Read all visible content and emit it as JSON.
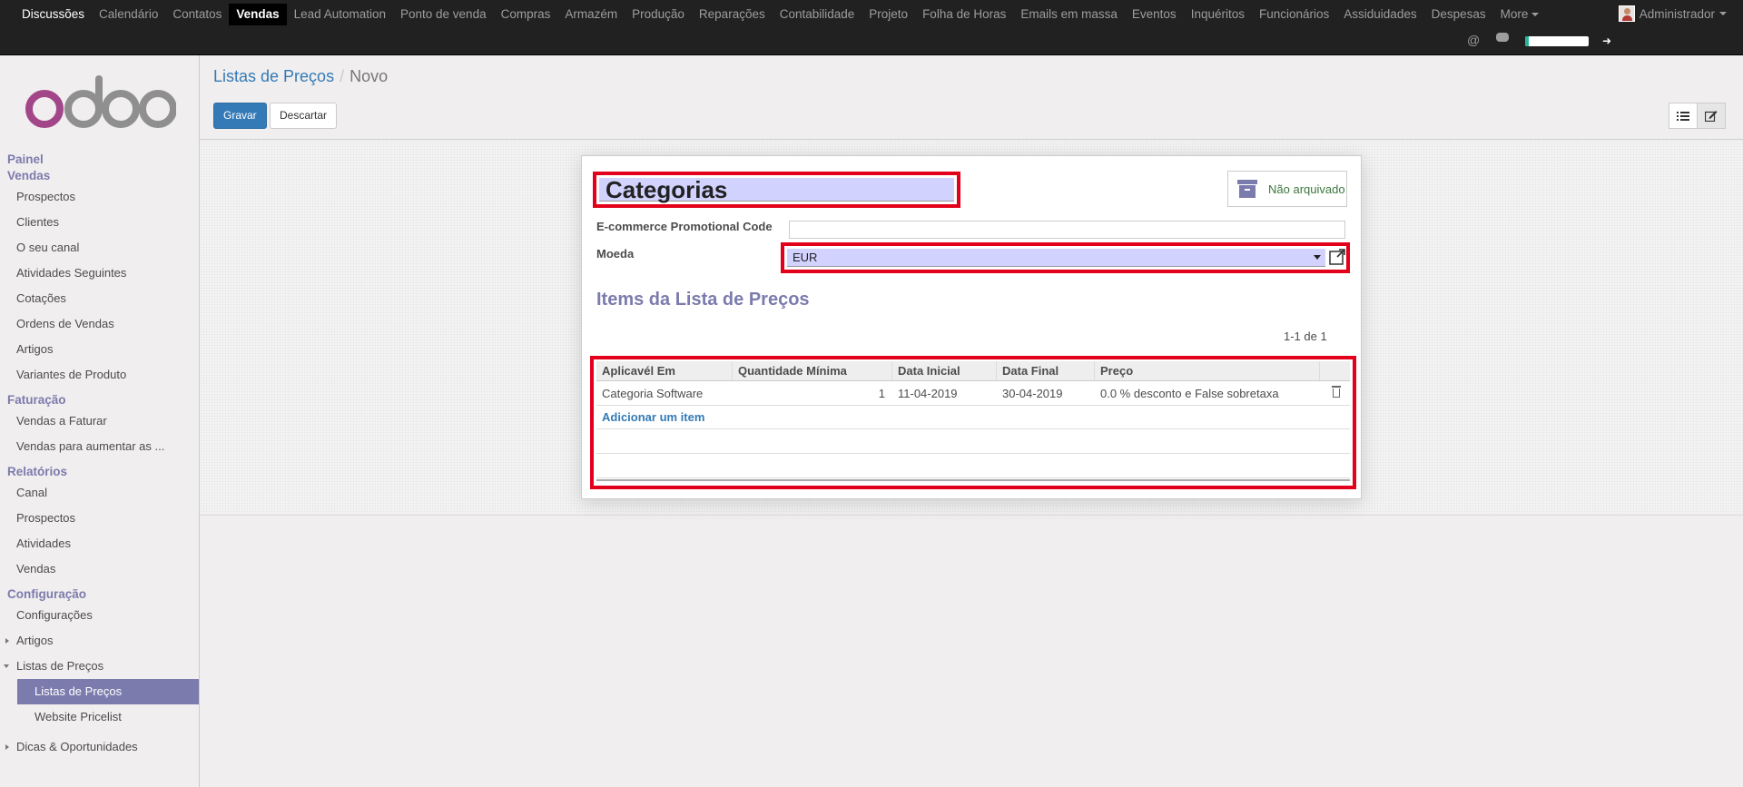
{
  "topmenu": {
    "items": [
      "Discussões",
      "Calendário",
      "Contatos",
      "Vendas",
      "Lead Automation",
      "Ponto de venda",
      "Compras",
      "Armazém",
      "Produção",
      "Reparações",
      "Contabilidade",
      "Projeto",
      "Folha de Horas",
      "Emails em massa",
      "Eventos",
      "Inquéritos",
      "Funcionários",
      "Assiduidades",
      "Despesas"
    ],
    "more": "More",
    "user": "Administrador",
    "at_symbol": "@",
    "timer_progress": 0.05
  },
  "sidebar": {
    "sections": [
      {
        "title": "Painel",
        "items": []
      },
      {
        "title": "Vendas",
        "items": [
          "Prospectos",
          "Clientes",
          "O seu canal",
          "Atividades Seguintes",
          "Cotações",
          "Ordens de Vendas",
          "Artigos",
          "Variantes de Produto"
        ]
      },
      {
        "title": "Faturação",
        "items": [
          "Vendas a Faturar",
          "Vendas para aumentar as ..."
        ]
      },
      {
        "title": "Relatórios",
        "items": [
          "Canal",
          "Prospectos",
          "Atividades",
          "Vendas"
        ]
      },
      {
        "title": "Configuração",
        "items": [
          "Configurações",
          "Artigos",
          "Listas de Preços",
          "Listas de Preços",
          "Website Pricelist",
          "Dicas & Oportunidades"
        ]
      }
    ]
  },
  "breadcrumb": {
    "parent": "Listas de Preços",
    "separator": "/",
    "current": "Novo"
  },
  "buttons": {
    "save": "Gravar",
    "discard": "Descartar"
  },
  "form": {
    "name": "Categorias",
    "archive_label": "Não arquivado",
    "promo_label": "E-commerce Promotional Code",
    "promo_value": "",
    "currency_label": "Moeda",
    "currency_value": "EUR",
    "items_title": "Items da Lista de Preços",
    "pager": "1-1 de 1"
  },
  "table": {
    "headers": [
      "Aplicavél Em",
      "Quantidade Mínima",
      "Data Inicial",
      "Data Final",
      "Preço"
    ],
    "rows": [
      {
        "applied_on": "Categoria Software",
        "min_qty": "1",
        "date_start": "11-04-2019",
        "date_end": "30-04-2019",
        "price": "0.0 % desconto e False sobretaxa"
      }
    ],
    "add_item": "Adicionar um item"
  },
  "colors": {
    "brand": "#7c7bad",
    "primary": "#337ab7",
    "highlight": "#e3001b",
    "required_field": "#d2d2ff"
  }
}
